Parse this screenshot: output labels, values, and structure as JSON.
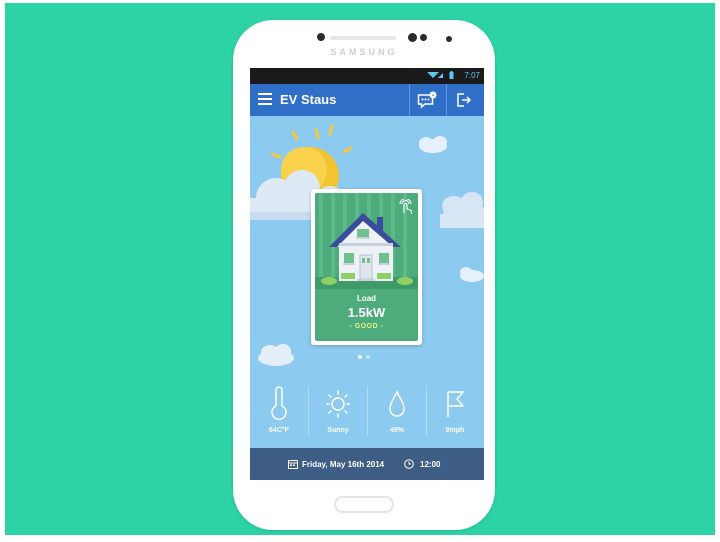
{
  "phone": {
    "brand": "SAMSUNG"
  },
  "status_bar": {
    "time": "7:07",
    "icons": [
      "wifi-icon",
      "signal-icon",
      "battery-icon"
    ]
  },
  "app_bar": {
    "title": "EV Staus",
    "menu_icon": "menu-icon",
    "messages_icon": "message-icon",
    "messages_badge": "•",
    "logout_icon": "logout-icon",
    "color": "#2f6fc8"
  },
  "card": {
    "label": "Load",
    "value": "1.5kW",
    "status": "- GOOD -",
    "status_color": "#e6f28a",
    "image": "house-illustration",
    "tap_icon": "touch-icon",
    "page_index": 1,
    "page_count": 2
  },
  "weather": [
    {
      "icon": "thermometer-icon",
      "label": "64C°F"
    },
    {
      "icon": "sun-icon",
      "label": "Sunny"
    },
    {
      "icon": "drop-icon",
      "label": "49%"
    },
    {
      "icon": "flag-icon",
      "label": "9mph"
    }
  ],
  "footer": {
    "date_icon": "calendar-icon",
    "date": "Friday, May 16th 2014",
    "time_icon": "clock-icon",
    "time": "12:00"
  },
  "colors": {
    "background": "#2dd2a5",
    "sky": "#8ccbef",
    "footer": "#3d5d84",
    "card_green": "#4eab7c"
  }
}
